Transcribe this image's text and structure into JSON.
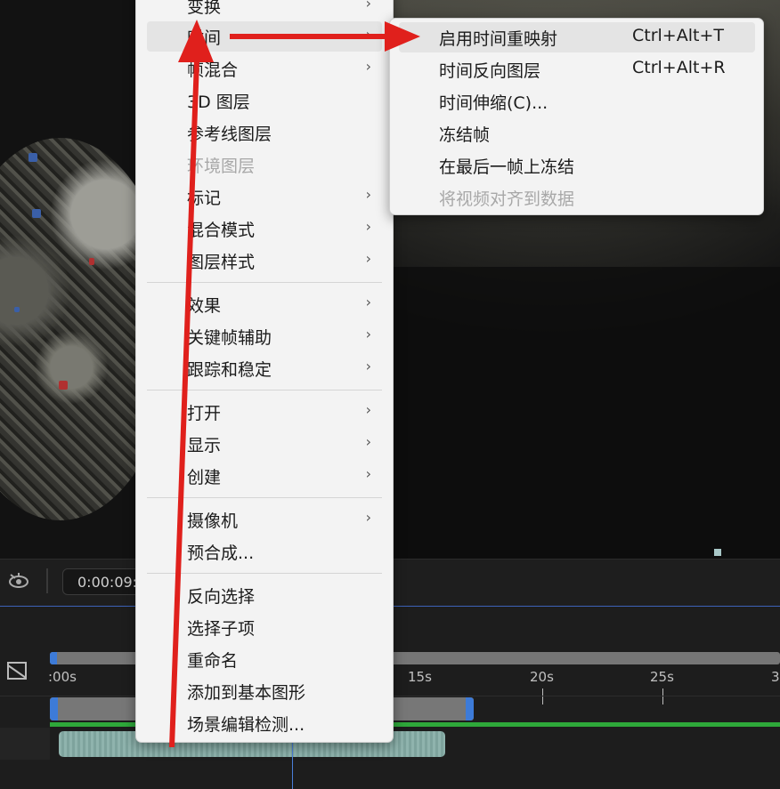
{
  "toolbar": {
    "timecode": "0:00:09:"
  },
  "timeline": {
    "ruler_labels": [
      ":00s",
      "15s",
      "20s",
      "25s",
      "3"
    ]
  },
  "context_menu": {
    "items": [
      {
        "label": "变换",
        "submenu": true
      },
      {
        "label": "时间",
        "submenu": true,
        "highlighted": true
      },
      {
        "label": "帧混合",
        "submenu": true
      },
      {
        "label": "3D 图层",
        "submenu": false
      },
      {
        "label": "参考线图层",
        "submenu": false
      },
      {
        "label": "环境图层",
        "submenu": false,
        "disabled": true
      },
      {
        "label": "标记",
        "submenu": true
      },
      {
        "label": "混合模式",
        "submenu": true
      },
      {
        "label": "图层样式",
        "submenu": true
      },
      {
        "label": "效果",
        "submenu": true
      },
      {
        "label": "关键帧辅助",
        "submenu": true
      },
      {
        "label": "跟踪和稳定",
        "submenu": true
      },
      {
        "label": "打开",
        "submenu": true
      },
      {
        "label": "显示",
        "submenu": true
      },
      {
        "label": "创建",
        "submenu": true
      },
      {
        "label": "摄像机",
        "submenu": true
      },
      {
        "label": "预合成...",
        "submenu": false
      },
      {
        "label": "反向选择",
        "submenu": false
      },
      {
        "label": "选择子项",
        "submenu": false
      },
      {
        "label": "重命名",
        "submenu": false
      },
      {
        "label": "添加到基本图形",
        "submenu": false
      },
      {
        "label": "场景编辑检测...",
        "submenu": false
      }
    ],
    "chevron": "›"
  },
  "time_submenu": {
    "items": [
      {
        "label": "启用时间重映射",
        "shortcut": "Ctrl+Alt+T",
        "highlighted": true
      },
      {
        "label": "时间反向图层",
        "shortcut": "Ctrl+Alt+R"
      },
      {
        "label": "时间伸缩(C)...",
        "shortcut": ""
      },
      {
        "label": "冻结帧",
        "shortcut": ""
      },
      {
        "label": "在最后一帧上冻结",
        "shortcut": ""
      },
      {
        "label": "将视频对齐到数据",
        "shortcut": "",
        "disabled": true
      }
    ]
  },
  "colors": {
    "arrow": "#e0201c",
    "accent_blue": "#3d7bd8",
    "green_bar": "#2ea83a"
  },
  "icons": [
    "eye-icon",
    "composition-icon",
    "chevron-right-icon"
  ]
}
